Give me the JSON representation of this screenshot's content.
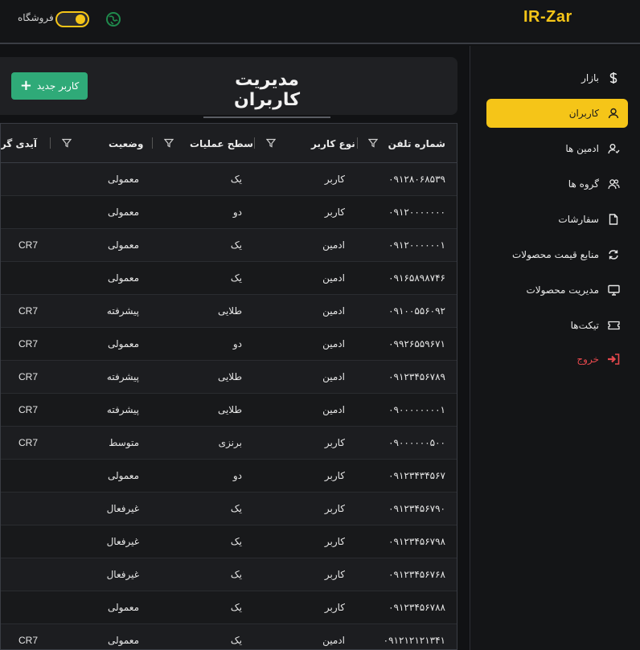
{
  "app": {
    "brand": "IR-Zar",
    "store_label": "فروشگاه"
  },
  "colors": {
    "accent": "#f5c518",
    "success": "#2faa78",
    "danger": "#e5484d"
  },
  "sidebar": {
    "items": [
      {
        "label": "بازار",
        "icon": "dollar-icon",
        "active": false
      },
      {
        "label": "کاربران",
        "icon": "user-icon",
        "active": true
      },
      {
        "label": "ادمین ها",
        "icon": "admin-icon",
        "active": false
      },
      {
        "label": "گروه ها",
        "icon": "group-icon",
        "active": false
      },
      {
        "label": "سفارشات",
        "icon": "file-icon",
        "active": false
      },
      {
        "label": "منابع قیمت محصولات",
        "icon": "refresh-icon",
        "active": false
      },
      {
        "label": "مدیریت محصولات",
        "icon": "monitor-icon",
        "active": false
      },
      {
        "label": "تیکت‌ها",
        "icon": "ticket-icon",
        "active": false
      },
      {
        "label": "خروج",
        "icon": "logout-icon",
        "active": false
      }
    ]
  },
  "header": {
    "title": "مدیریت کاربران",
    "add_button": "کاربر جدید"
  },
  "table": {
    "columns": [
      "شماره تلفن",
      "نوع کاربر",
      "سطح عملیات",
      "وضعیت",
      "آیدی گروه"
    ],
    "rows": [
      {
        "phone": "۰۹۱۲۸۰۶۸۵۳۹",
        "type": "کاربر",
        "level": "یک",
        "status": "معمولی",
        "gid": ""
      },
      {
        "phone": "۰۹۱۲۰۰۰۰۰۰۰",
        "type": "کاربر",
        "level": "دو",
        "status": "معمولی",
        "gid": ""
      },
      {
        "phone": "۰۹۱۲۰۰۰۰۰۰۱",
        "type": "ادمین",
        "level": "یک",
        "status": "معمولی",
        "gid": "CR7"
      },
      {
        "phone": "۰۹۱۶۵۸۹۸۷۴۶",
        "type": "ادمین",
        "level": "یک",
        "status": "معمولی",
        "gid": ""
      },
      {
        "phone": "۰۹۱۰۰۵۵۶۰۹۲",
        "type": "ادمین",
        "level": "طلایی",
        "status": "پیشرفته",
        "gid": "CR7"
      },
      {
        "phone": "۰۹۹۲۶۵۵۹۶۷۱",
        "type": "ادمین",
        "level": "دو",
        "status": "معمولی",
        "gid": "CR7"
      },
      {
        "phone": "۰۹۱۲۳۴۵۶۷۸۹",
        "type": "ادمین",
        "level": "طلایی",
        "status": "پیشرفته",
        "gid": "CR7"
      },
      {
        "phone": "۰۹۰۰۰۰۰۰۰۰۱",
        "type": "ادمین",
        "level": "طلایی",
        "status": "پیشرفته",
        "gid": "CR7"
      },
      {
        "phone": "۰۹۰۰۰۰۰۰۵۰۰",
        "type": "کاربر",
        "level": "برنزی",
        "status": "متوسط",
        "gid": "CR7"
      },
      {
        "phone": "۰۹۱۲۳۴۳۴۵۶۷",
        "type": "کاربر",
        "level": "دو",
        "status": "معمولی",
        "gid": ""
      },
      {
        "phone": "۰۹۱۲۳۴۵۶۷۹۰",
        "type": "کاربر",
        "level": "یک",
        "status": "غیرفعال",
        "gid": ""
      },
      {
        "phone": "۰۹۱۲۳۴۵۶۷۹۸",
        "type": "کاربر",
        "level": "یک",
        "status": "غیرفعال",
        "gid": ""
      },
      {
        "phone": "۰۹۱۲۳۴۵۶۷۶۸",
        "type": "کاربر",
        "level": "یک",
        "status": "غیرفعال",
        "gid": ""
      },
      {
        "phone": "۰۹۱۲۳۴۵۶۷۸۸",
        "type": "کاربر",
        "level": "یک",
        "status": "معمولی",
        "gid": ""
      },
      {
        "phone": "۰۹۱۲۱۲۱۲۱۳۴۱",
        "type": "ادمین",
        "level": "یک",
        "status": "معمولی",
        "gid": "CR7"
      }
    ]
  }
}
